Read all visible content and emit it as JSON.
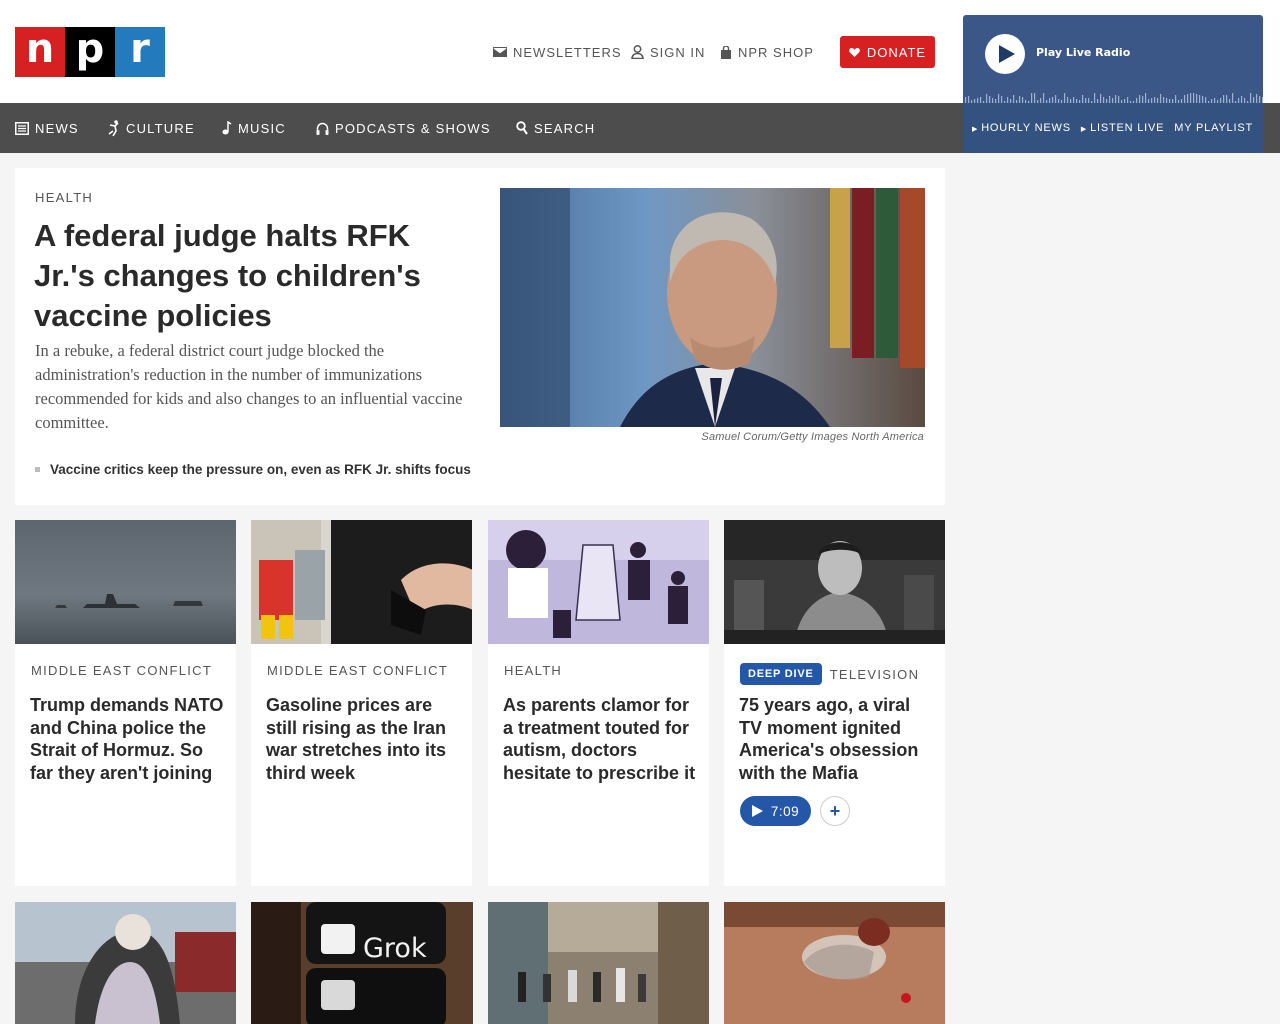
{
  "header": {
    "logo": {
      "letters": [
        "n",
        "p",
        "r"
      ],
      "colors": [
        "#d62021",
        "#000000",
        "#237bbd"
      ]
    },
    "utility": {
      "newsletters": "NEWSLETTERS",
      "sign_in": "SIGN IN",
      "shop": "NPR SHOP"
    },
    "donate": "DONATE"
  },
  "radio": {
    "label": "Play Live Radio",
    "links": [
      "HOURLY NEWS",
      "LISTEN LIVE",
      "MY PLAYLIST"
    ]
  },
  "nav": {
    "news": "NEWS",
    "culture": "CULTURE",
    "music": "MUSIC",
    "podcasts": "PODCASTS & SHOWS",
    "search": "SEARCH"
  },
  "lead": {
    "slug": "HEALTH",
    "headline": "A federal judge halts RFK Jr.'s changes to children's vaccine policies",
    "teaser": "In a rebuke, a federal district court judge blocked the administration's reduction in the number of immunizations recommended for kids and also changes to an influential vaccine committee.",
    "credit": "Samuel Corum/Getty Images North America",
    "related": "Vaccine critics keep the pressure on, even as RFK Jr. shifts focus"
  },
  "cards": [
    {
      "slug": "MIDDLE EAST CONFLICT",
      "title": "Trump demands NATO and China police the Strait of Hormuz. So far they aren't joining"
    },
    {
      "slug": "MIDDLE EAST CONFLICT",
      "title": "Gasoline prices are still rising as the Iran war stretches into its third week"
    },
    {
      "slug": "HEALTH",
      "title": "As parents clamor for a treatment touted for autism, doctors hesitate to prescribe it"
    },
    {
      "badge": "DEEP DIVE",
      "slug": "TELEVISION",
      "title": "75 years ago, a viral TV moment ignited America's obsession with the Mafia",
      "audio_duration": "7:09",
      "add_label": "+"
    }
  ],
  "row2": {
    "grok_text": "Grok"
  },
  "colors": {
    "brand_red": "#d62021",
    "nav_bg": "#4d4d4d",
    "radio_bg": "#3a5787",
    "accent_blue": "#2457a8"
  }
}
